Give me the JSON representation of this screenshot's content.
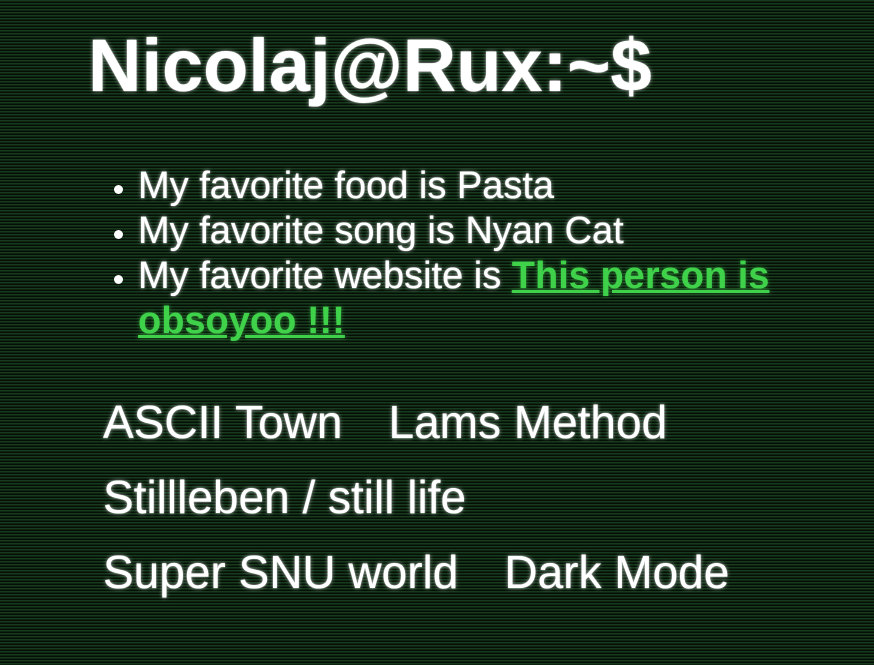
{
  "header": {
    "title": "Nicolaj@Rux:~$"
  },
  "favorites": [
    {
      "text": "My favorite food is Pasta"
    },
    {
      "text": "My favorite song is Nyan Cat"
    },
    {
      "text": "My favorite website is ",
      "link_text": "This person is obsoyoo !!!"
    }
  ],
  "nav": {
    "rows": [
      [
        "ASCII Town",
        "Lams Method"
      ],
      [
        "Stillleben / still life"
      ],
      [
        "Super SNU world",
        "Dark Mode"
      ]
    ]
  },
  "colors": {
    "background": "#0b1f0e",
    "text": "#ffffff",
    "link": "#3fd14a"
  }
}
